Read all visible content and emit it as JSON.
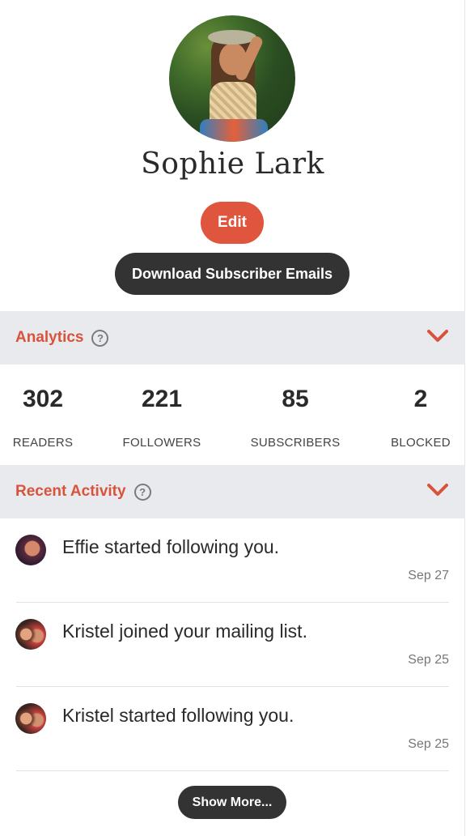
{
  "profile": {
    "name": "Sophie Lark",
    "edit_label": "Edit",
    "download_label": "Download Subscriber Emails"
  },
  "analytics": {
    "title": "Analytics",
    "help_icon": "question-circle-icon",
    "toggle_icon": "chevron-down-icon",
    "stats": [
      {
        "value": "302",
        "label": "READERS"
      },
      {
        "value": "221",
        "label": "FOLLOWERS"
      },
      {
        "value": "85",
        "label": "SUBSCRIBERS"
      },
      {
        "value": "2",
        "label": "BLOCKED"
      }
    ]
  },
  "recent_activity": {
    "title": "Recent Activity",
    "help_icon": "question-circle-icon",
    "toggle_icon": "chevron-down-icon",
    "items": [
      {
        "text": "Effie started following you.",
        "date": "Sep 27"
      },
      {
        "text": "Kristel joined your mailing list.",
        "date": "Sep 25"
      },
      {
        "text": "Kristel started following you.",
        "date": "Sep 25"
      }
    ],
    "show_more_label": "Show More..."
  },
  "colors": {
    "accent": "#e0553e",
    "dark_button": "#333333",
    "section_bg": "#e8eaed"
  }
}
